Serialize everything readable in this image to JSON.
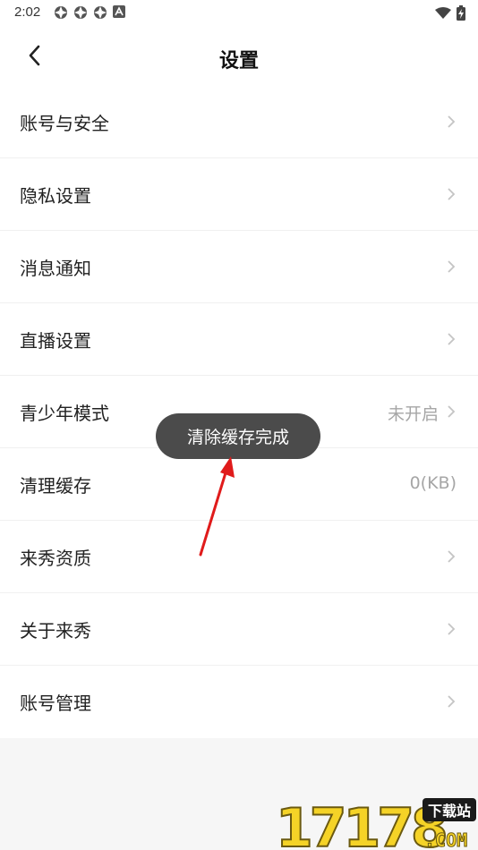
{
  "status_bar": {
    "time": "2:02",
    "icons": [
      "notification-icon",
      "notification-icon",
      "notification-icon",
      "a-icon"
    ],
    "right_icons": [
      "wifi-icon",
      "battery-charging-icon"
    ]
  },
  "header": {
    "title": "设置",
    "back_icon": "chevron-left-icon"
  },
  "settings": [
    {
      "label": "账号与安全",
      "value": "",
      "chevron": true
    },
    {
      "label": "隐私设置",
      "value": "",
      "chevron": true
    },
    {
      "label": "消息通知",
      "value": "",
      "chevron": true
    },
    {
      "label": "直播设置",
      "value": "",
      "chevron": true
    },
    {
      "label": "青少年模式",
      "value": "未开启",
      "chevron": true
    },
    {
      "label": "清理缓存",
      "value": "0(KB)",
      "chevron": false
    },
    {
      "label": "来秀资质",
      "value": "",
      "chevron": true
    },
    {
      "label": "关于来秀",
      "value": "",
      "chevron": true
    },
    {
      "label": "账号管理",
      "value": "",
      "chevron": true
    }
  ],
  "toast": {
    "text": "清除缓存完成"
  },
  "annotation": {
    "arrow_color": "#e01b1b"
  },
  "watermark": {
    "number": "17178",
    "badge": "下载站",
    "domain": ".COM"
  }
}
